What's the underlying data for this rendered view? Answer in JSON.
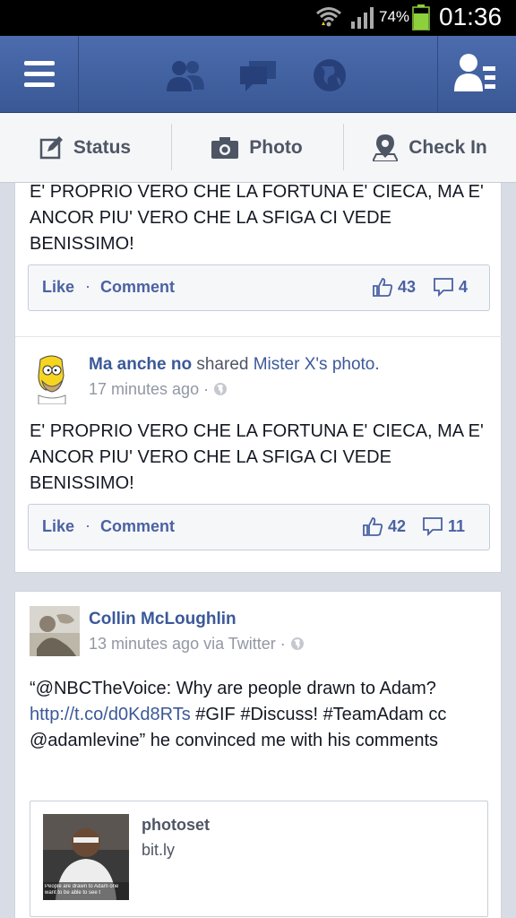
{
  "status_bar": {
    "battery_percent": "74%",
    "time": "01:36",
    "icons": [
      "wifi-icon",
      "signal-icon",
      "battery-icon"
    ]
  },
  "nav": {
    "icons": [
      "menu-icon",
      "friend-requests-icon",
      "messages-icon",
      "notifications-globe-icon",
      "friends-list-icon"
    ]
  },
  "composer": {
    "status_label": "Status",
    "photo_label": "Photo",
    "checkin_label": "Check In"
  },
  "posts": [
    {
      "text": "E' PROPRIO VERO CHE LA FORTUNA E' CIECA, MA E' ANCOR PIU' VERO CHE LA SFIGA CI VEDE BENISSIMO!",
      "like_label": "Like",
      "dot": "·",
      "comment_label": "Comment",
      "likes": "43",
      "comments": "4"
    },
    {
      "author": "Ma anche no",
      "action": " shared ",
      "shared_from": "Mister X's photo.",
      "time": "17 minutes ago · ",
      "text": "E' PROPRIO VERO CHE LA FORTUNA E' CIECA, MA E' ANCOR PIU' VERO CHE LA SFIGA CI VEDE BENISSIMO!",
      "like_label": "Like",
      "dot": "·",
      "comment_label": "Comment",
      "likes": "42",
      "comments": "11"
    },
    {
      "author": "Collin McLoughlin",
      "time": "13 minutes ago via Twitter · ",
      "text_start": "“@NBCTheVoice: Why are people drawn to Adam? ",
      "text_link": "http://t.co/d0Kd8RTs",
      "text_end": " #GIF #Discuss! #TeamAdam cc @adamlevine” he convinced me with his comments",
      "attachment_title": "photoset",
      "attachment_domain": "bit.ly",
      "thumb_caption": "People are drawn to Adam one want to be able to see t"
    }
  ],
  "colors": {
    "brand": "#3b5998",
    "link": "#3b5998",
    "background": "#d8dce4"
  }
}
